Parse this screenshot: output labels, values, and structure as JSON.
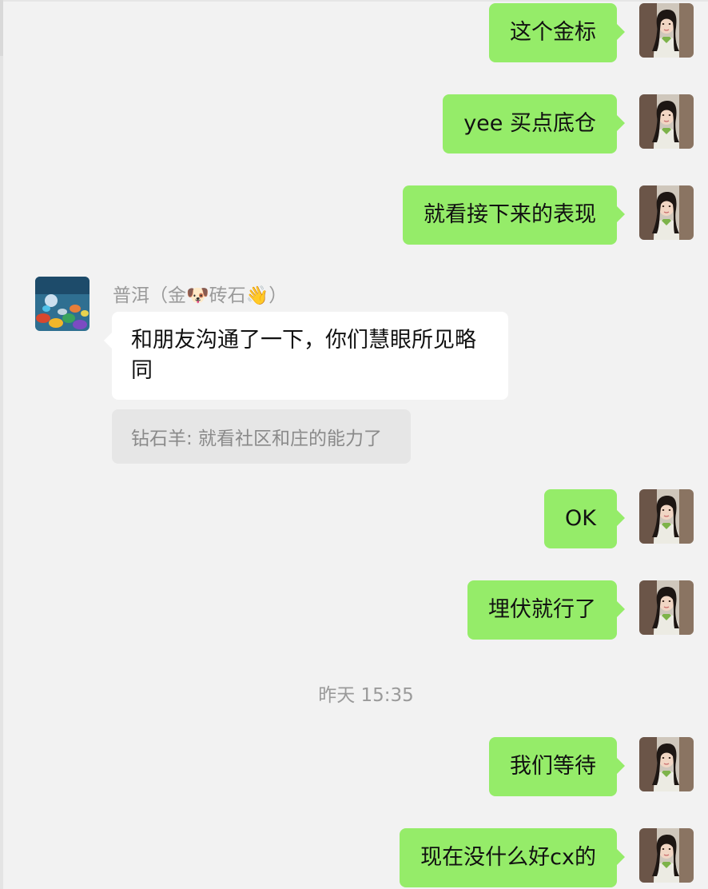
{
  "messages": [
    {
      "id": "m1",
      "text": "这个金标"
    },
    {
      "id": "m2",
      "text": "yee 买点底仓"
    },
    {
      "id": "m3",
      "text": "就看接下来的表现"
    },
    {
      "id": "m4",
      "sender": "普洱（金🐶砖石👋）",
      "text": "和朋友沟通了一下，你们慧眼所见略同",
      "quote": "钻石羊: 就看社区和庄的能力了"
    },
    {
      "id": "m5",
      "text": "OK"
    },
    {
      "id": "m6",
      "text": "埋伏就行了"
    },
    {
      "id": "m7",
      "text": "我们等待"
    },
    {
      "id": "m8",
      "text": "现在没什么好cx的"
    }
  ],
  "timestamp": "昨天 15:35",
  "colors": {
    "background": "#f2f2f2",
    "my_bubble": "#95ec69",
    "other_bubble": "#ffffff",
    "quote_bg": "#e6e6e6",
    "meta_text": "#9a9a9a"
  },
  "icons": {
    "my_avatar": "woman-portrait-avatar",
    "other_avatar": "colorful-stones-avatar"
  }
}
